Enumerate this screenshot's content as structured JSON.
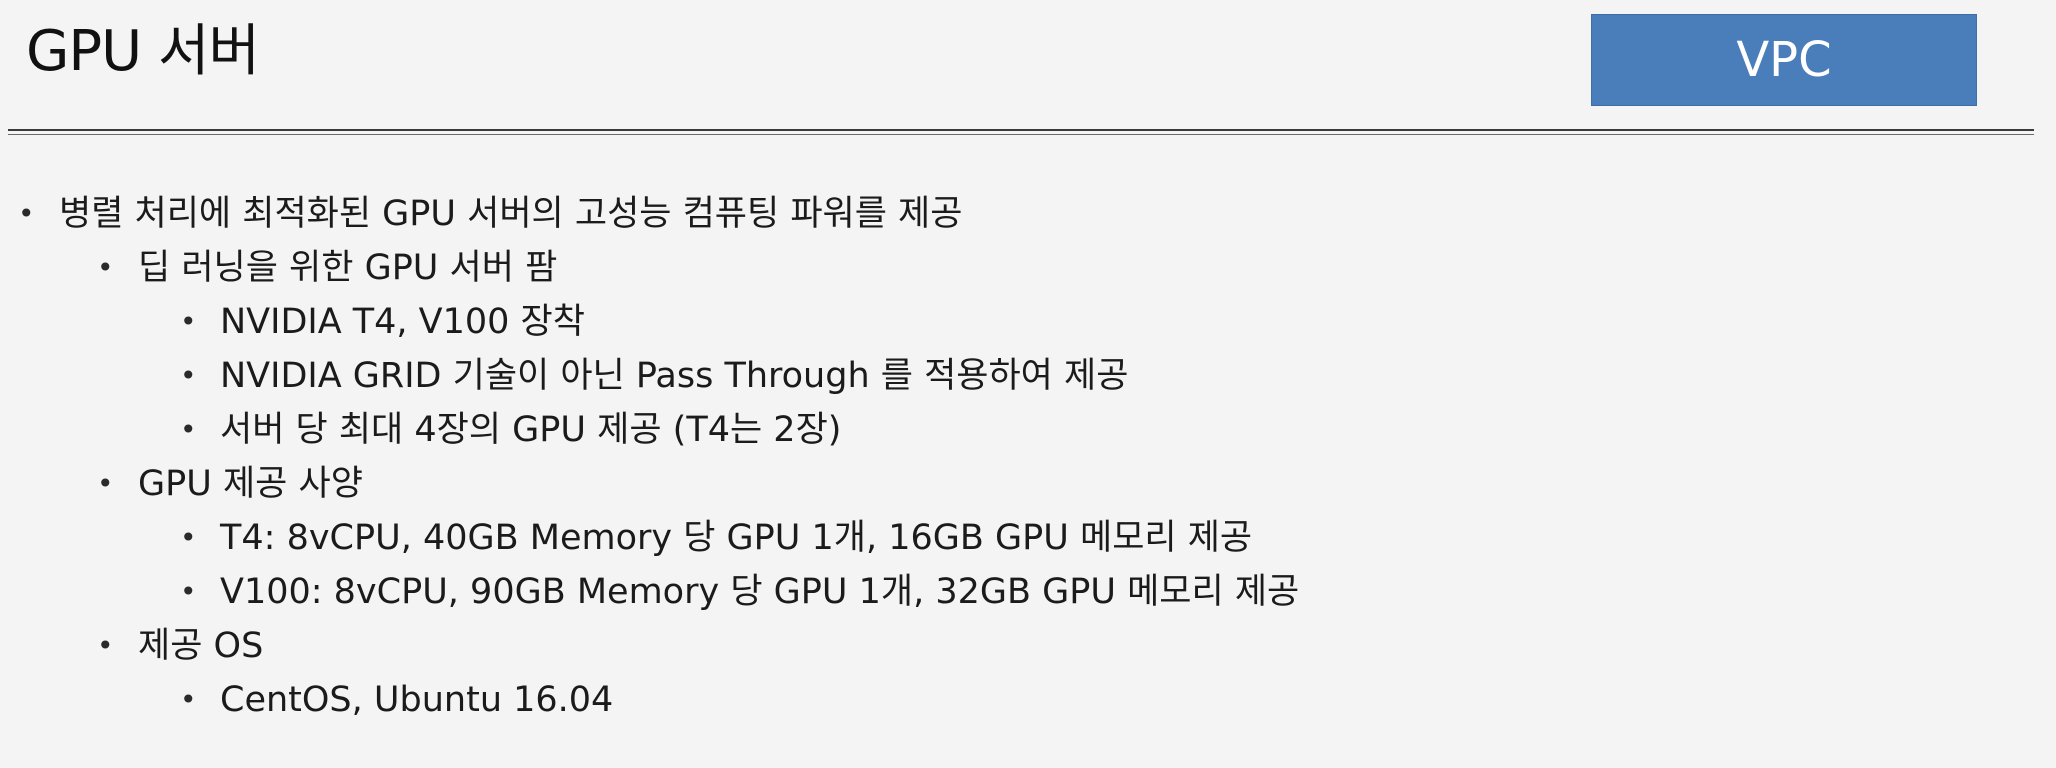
{
  "slide": {
    "title": "GPU 서버",
    "badge": "VPC",
    "colors": {
      "background": "#f4f4f4",
      "badge_fill": "#4a7ebb",
      "badge_text": "#ffffff",
      "text": "#1b1b1b",
      "rule": "#3a3a3a"
    },
    "bullets": [
      {
        "level": 1,
        "text": "병렬 처리에 최적화된 GPU 서버의 고성능 컴퓨팅 파워를 제공"
      },
      {
        "level": 2,
        "text": "딥 러닝을 위한 GPU 서버 팜"
      },
      {
        "level": 3,
        "text": "NVIDIA T4, V100 장착"
      },
      {
        "level": 3,
        "text": "NVIDIA GRID 기술이 아닌 Pass Through 를 적용하여 제공"
      },
      {
        "level": 3,
        "text": "서버 당 최대 4장의 GPU 제공 (T4는 2장)"
      },
      {
        "level": 2,
        "text": "GPU 제공 사양"
      },
      {
        "level": 3,
        "text": "T4: 8vCPU, 40GB Memory 당 GPU 1개, 16GB GPU 메모리 제공"
      },
      {
        "level": 3,
        "text": "V100: 8vCPU, 90GB Memory 당 GPU 1개, 32GB GPU 메모리 제공"
      },
      {
        "level": 2,
        "text": "제공 OS"
      },
      {
        "level": 3,
        "text": "CentOS, Ubuntu 16.04"
      }
    ]
  }
}
